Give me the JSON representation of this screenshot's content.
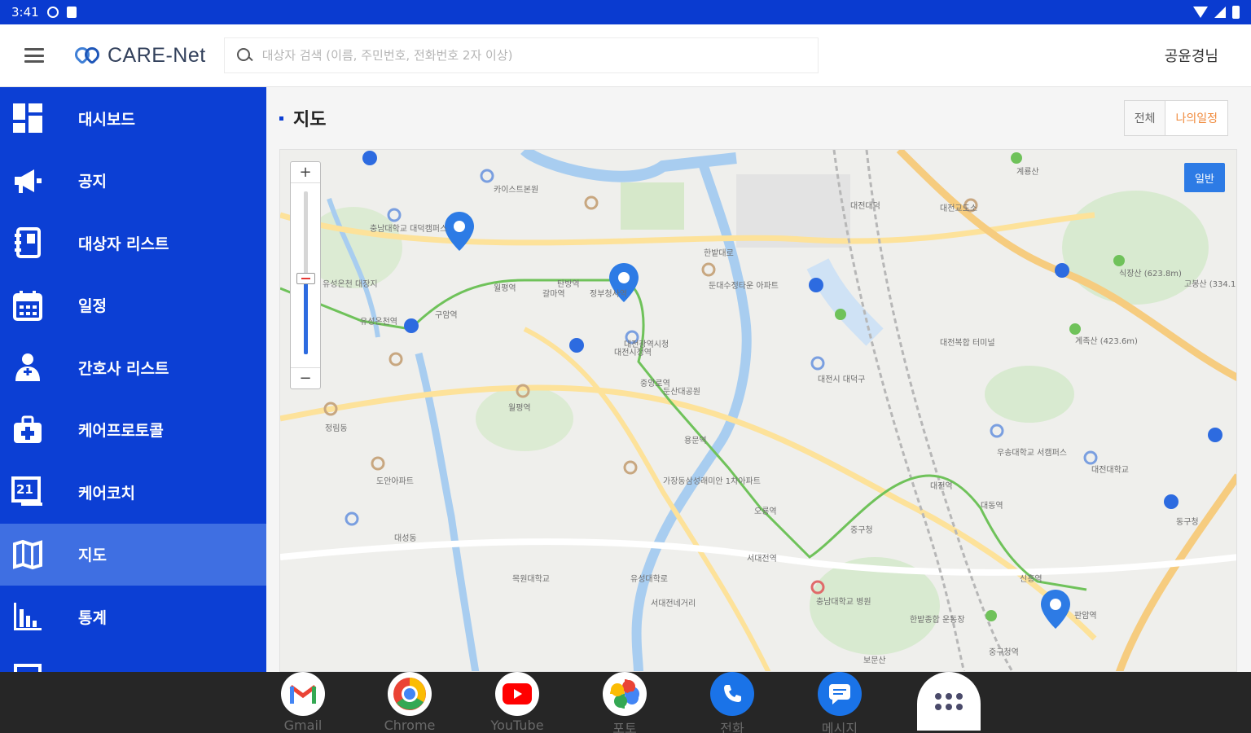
{
  "status_bar": {
    "time": "3:41"
  },
  "header": {
    "logo_text": "CARE-Net",
    "search_placeholder": "대상자 검색 (이름, 주민번호, 전화번호 2자 이상)",
    "user": "공윤경님"
  },
  "sidebar": {
    "items": [
      {
        "label": "대시보드",
        "icon": "dashboard-icon",
        "active": false
      },
      {
        "label": "공지",
        "icon": "megaphone-icon",
        "active": false
      },
      {
        "label": "대상자 리스트",
        "icon": "notebook-icon",
        "active": false
      },
      {
        "label": "일정",
        "icon": "calendar-icon",
        "active": false
      },
      {
        "label": "간호사 리스트",
        "icon": "nurse-icon",
        "active": false
      },
      {
        "label": "케어프로토콜",
        "icon": "medical-kit-icon",
        "active": false
      },
      {
        "label": "케어코치",
        "icon": "chat-board-icon",
        "active": false
      },
      {
        "label": "지도",
        "icon": "map-icon",
        "active": true
      },
      {
        "label": "통계",
        "icon": "bar-chart-icon",
        "active": false
      }
    ]
  },
  "main": {
    "title": "지도",
    "filter": {
      "all": "전체",
      "mine": "나의일정"
    },
    "map": {
      "zoom_in": "+",
      "zoom_out": "−",
      "map_type": "일반",
      "labels": [
        "카이스트본원",
        "충남대학교 대덕캠퍼스",
        "유성온천 대장지",
        "유성온천역",
        "구암역",
        "월평역",
        "갈마역",
        "정부청사역",
        "대전시청역",
        "대전광역시청",
        "둔산대공원",
        "둔대수정타운 아파트",
        "한밭대로",
        "대전교도소",
        "대전대덕",
        "대전복합 터미널",
        "대전시 대덕구",
        "우송대학교 서캠퍼스",
        "대전대학교",
        "동구청",
        "대전역",
        "중구청",
        "서대전역",
        "서대전네거리",
        "유성대학로",
        "목원대학교",
        "도안아파트",
        "가장동삼성래미안 1차아파트",
        "월평역",
        "계룡산",
        "식장산 (623.8m)",
        "계족산 (423.6m)",
        "고봉산 (334.1m)",
        "신흥역",
        "대동역",
        "판암역",
        "충남대학교 병원",
        "한밭종합 운동장",
        "보문산",
        "대성동",
        "정림동",
        "용문역",
        "탄방역",
        "오룡역",
        "중앙로역",
        "중구청역"
      ]
    }
  },
  "dock": {
    "apps": [
      {
        "label": "Gmail",
        "icon": "gmail-icon"
      },
      {
        "label": "Chrome",
        "icon": "chrome-icon"
      },
      {
        "label": "YouTube",
        "icon": "youtube-icon"
      },
      {
        "label": "포토",
        "icon": "photos-icon"
      },
      {
        "label": "전화",
        "icon": "phone-icon"
      },
      {
        "label": "메시지",
        "icon": "messages-icon"
      }
    ]
  }
}
